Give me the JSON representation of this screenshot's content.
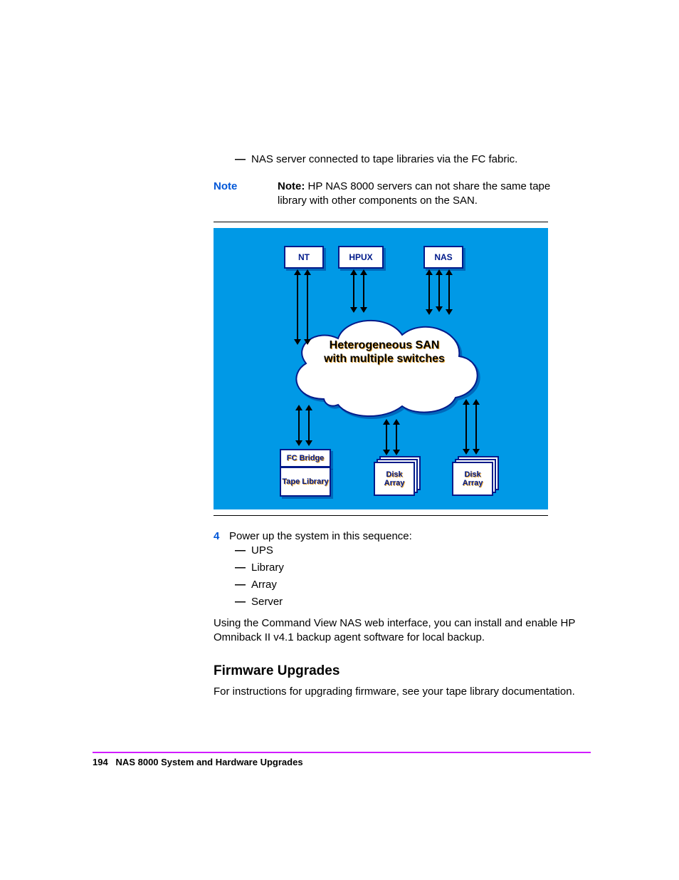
{
  "bullet1": "NAS server connected to tape libraries via the FC fabric.",
  "note": {
    "label": "Note",
    "bold": "Note:",
    "text": " HP NAS 8000 servers can not share the same tape library with other components on the SAN."
  },
  "diagram": {
    "top": {
      "nt": "NT",
      "hpux": "HPUX",
      "nas": "NAS"
    },
    "cloud": "Heterogeneous SAN with multiple switches",
    "bottom": {
      "fcbridge": "FC Bridge",
      "tapelib": "Tape Library",
      "disk1": "Disk Array",
      "disk2": "Disk Array"
    }
  },
  "step4": {
    "num": "4",
    "text": "Power up the system in this sequence:",
    "items": [
      "UPS",
      "Library",
      "Array",
      "Server"
    ]
  },
  "para2": "Using the Command View NAS web interface, you can install and enable HP Omniback II v4.1 backup agent software for local backup.",
  "heading": "Firmware Upgrades",
  "para3": "For instructions for upgrading firmware, see your tape library documentation.",
  "footer": {
    "page": "194",
    "title": "NAS 8000 System and Hardware Upgrades"
  }
}
